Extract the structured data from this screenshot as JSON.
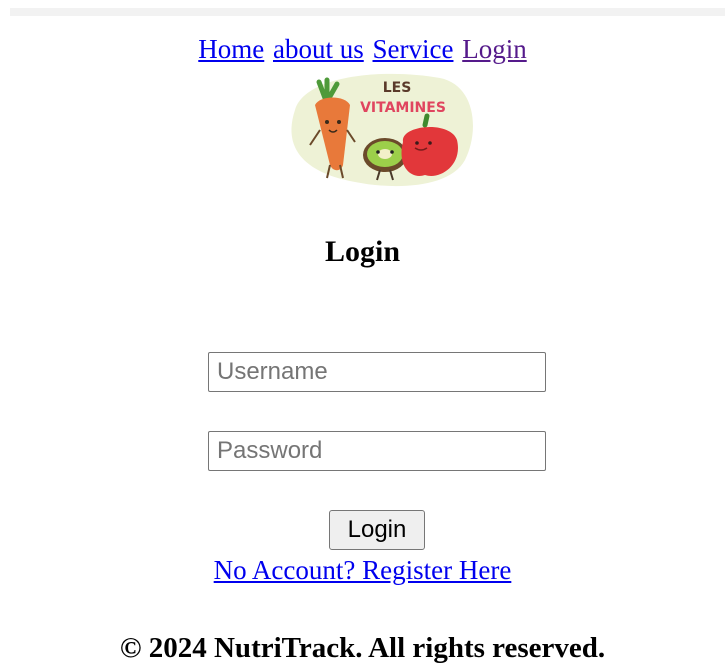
{
  "nav": {
    "items": [
      {
        "label": "Home",
        "state": "link"
      },
      {
        "label": "about us",
        "state": "link"
      },
      {
        "label": "Service",
        "state": "link"
      },
      {
        "label": "Login",
        "state": "visited"
      }
    ]
  },
  "logo": {
    "line1": "LES",
    "line2": "VITAMINES"
  },
  "login": {
    "title": "Login",
    "username_placeholder": "Username",
    "password_placeholder": "Password",
    "button_label": "Login",
    "register_text": "No Account? Register Here"
  },
  "footer": {
    "text": "© 2024 NutriTrack. All rights reserved."
  },
  "colors": {
    "link": "#0000ee",
    "visited": "#551a8b",
    "logo_blob": "#eef2d6",
    "logo_text": "#e0455f",
    "carrot": "#e8793a",
    "pepper": "#e2373a"
  }
}
